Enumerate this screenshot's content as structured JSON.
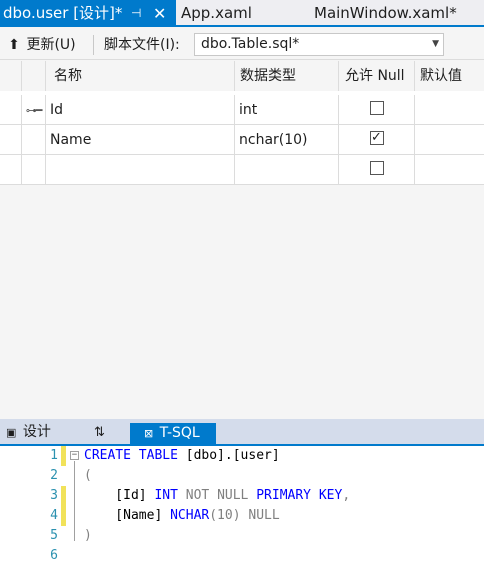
{
  "doc_tabs": {
    "active": {
      "label": "dbo.user [设计]*",
      "pin": "⊣",
      "close": "✕"
    },
    "tab2": "App.xaml",
    "tab3": "MainWindow.xaml*"
  },
  "toolbar": {
    "update_label": "更新(U)",
    "script_file_label": "脚本文件(I):",
    "script_file_value": "dbo.Table.sql*"
  },
  "grid": {
    "headers": {
      "name": "名称",
      "type": "数据类型",
      "allow_null": "允许 Null",
      "default": "默认值"
    },
    "rows": [
      {
        "key": true,
        "name": "Id",
        "type": "int",
        "allow_null": false
      },
      {
        "key": false,
        "name": "Name",
        "type": "nchar(10)",
        "allow_null": true
      },
      {
        "key": false,
        "name": "",
        "type": "",
        "allow_null": false
      }
    ]
  },
  "pane_tabs": {
    "design": "设计",
    "swap": "⇅",
    "tsql": "T-SQL"
  },
  "editor": {
    "line_numbers": [
      "1",
      "2",
      "3",
      "4",
      "5",
      "6"
    ],
    "lines": {
      "l1_kw": "CREATE TABLE",
      "l1_rest": " [dbo].[user]",
      "l2": "(",
      "l3_name": "    [Id] ",
      "l3_type": "INT",
      "l3_nn": " NOT NULL ",
      "l3_pk": "PRIMARY KEY",
      "l3_end": ",",
      "l4_name": "    [Name] ",
      "l4_type": "NCHAR",
      "l4_paren": "(10)",
      "l4_null": " NULL",
      "l5": ")",
      "l6": ""
    }
  },
  "colors": {
    "accent": "#007acc",
    "change_marker": "#f1e25a",
    "keyword": "#0000ff",
    "line_number": "#2b91af"
  }
}
